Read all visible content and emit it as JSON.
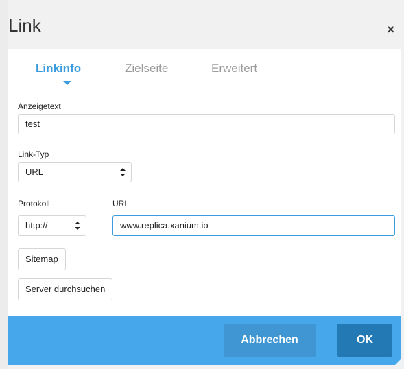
{
  "dialog": {
    "title": "Link",
    "close_glyph": "×",
    "tabs": [
      {
        "label": "Linkinfo",
        "active": true
      },
      {
        "label": "Zielseite",
        "active": false
      },
      {
        "label": "Erweitert",
        "active": false
      }
    ],
    "display_text": {
      "label": "Anzeigetext",
      "value": "test"
    },
    "link_type": {
      "label": "Link-Typ",
      "value": "URL"
    },
    "protocol": {
      "label": "Protokoll",
      "value": "http://"
    },
    "url": {
      "label": "URL",
      "value": "www.replica.xanium.io"
    },
    "sitemap_button": "Sitemap",
    "browse_server_button": "Server durchsuchen",
    "cancel_button": "Abbrechen",
    "ok_button": "OK"
  },
  "colors": {
    "accent": "#3a9bde",
    "footer_bg": "#47a7eb",
    "ok_bg": "#2379b4",
    "cancel_bg": "#3f96d2"
  },
  "icons": {
    "close": "close-icon",
    "select_arrows": "updown-arrows-icon",
    "tab_indicator": "caret-down-icon",
    "resize": "resize-grip-icon"
  }
}
